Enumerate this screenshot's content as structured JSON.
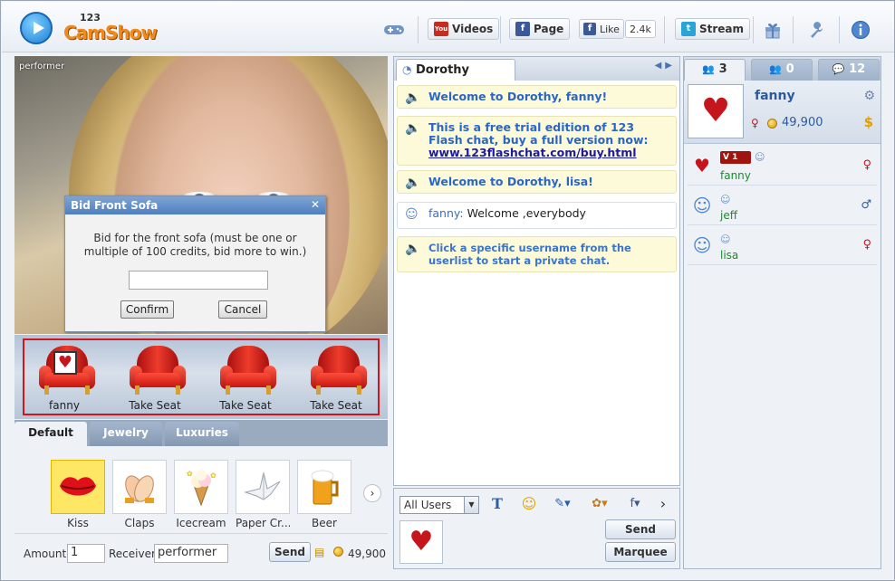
{
  "app": {
    "logo_small": "123",
    "logo_name": "CamShow"
  },
  "toolbar": {
    "videos_label": "Videos",
    "page_label": "Page",
    "like_label": "Like",
    "like_count": "2.4k",
    "stream_label": "Stream",
    "icons": [
      "gamepad-icon",
      "youtube-icon",
      "facebook-icon",
      "twitter-icon",
      "gift-icon",
      "wrench-icon",
      "info-icon"
    ]
  },
  "video": {
    "performer_label": "performer"
  },
  "bid_dialog": {
    "title": "Bid Front Sofa",
    "message": "Bid for the front sofa (must be one or multiple of 100 credits, bid more to win.)",
    "input_value": "",
    "confirm_label": "Confirm",
    "cancel_label": "Cancel"
  },
  "sofas": [
    {
      "label": "fanny"
    },
    {
      "label": "Take Seat"
    },
    {
      "label": "Take Seat"
    },
    {
      "label": "Take Seat"
    }
  ],
  "gifts": {
    "tabs": [
      "Default",
      "Jewelry",
      "Luxuries"
    ],
    "items": [
      {
        "label": "Kiss",
        "icon": "kiss-icon"
      },
      {
        "label": "Claps",
        "icon": "claps-icon"
      },
      {
        "label": "Icecream",
        "icon": "icecream-icon"
      },
      {
        "label": "Paper Cr...",
        "icon": "paper-crane-icon"
      },
      {
        "label": "Beer",
        "icon": "beer-icon"
      }
    ],
    "amount_label": "Amount",
    "amount_value": "1",
    "receiver_label": "Receiver",
    "receiver_value": "performer",
    "send_label": "Send",
    "credits": "49,900"
  },
  "chat": {
    "room_tab": "Dorothy",
    "messages": [
      {
        "type": "system",
        "text": "Welcome to Dorothy, fanny!"
      },
      {
        "type": "system",
        "text": "This is a free trial edition of 123 Flash chat, buy a full version now: ",
        "link": "www.123flashchat.com/buy.html"
      },
      {
        "type": "system",
        "text": "Welcome to Dorothy, lisa!"
      },
      {
        "type": "user",
        "user": "fanny:",
        "text": " Welcome ,everybody"
      },
      {
        "type": "hint",
        "text": "Click a specific username from the userlist to start a private chat."
      }
    ],
    "recipient": "All Users",
    "send_label": "Send",
    "marquee_label": "Marquee"
  },
  "users_panel": {
    "tabs": [
      {
        "label": "3"
      },
      {
        "label": "0"
      },
      {
        "label": "12"
      }
    ],
    "me": {
      "name": "fanny",
      "credits": "49,900"
    },
    "list": [
      {
        "name": "fanny",
        "badge": "1",
        "gender": "female"
      },
      {
        "name": "jeff",
        "gender": "male"
      },
      {
        "name": "lisa",
        "gender": "female"
      }
    ]
  }
}
